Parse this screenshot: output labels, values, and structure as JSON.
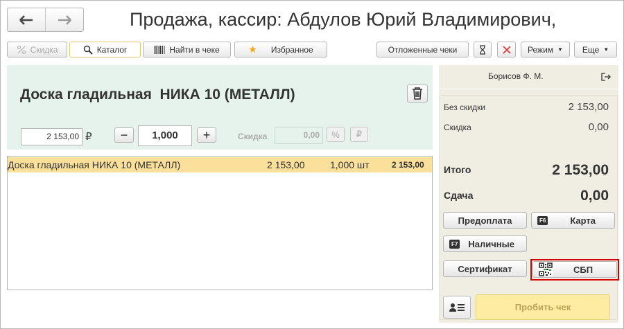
{
  "window": {
    "title": "Продажа, кассир: Абдулов Юрий Владимирович,"
  },
  "toolbar": {
    "discount_label": "Скидка",
    "catalog_label": "Каталог",
    "find_in_check_label": "Найти в чеке",
    "favorites_label": "Избранное",
    "deferred_checks_label": "Отложенные чеки",
    "mode_label": "Режим",
    "more_label": "Еще"
  },
  "product": {
    "name": "Доска гладильная  НИКА 10 (МЕТАЛЛ)",
    "price": "2 153,00",
    "currency_symbol": "₽",
    "quantity": "1,000",
    "discount_label": "Скидка",
    "discount_value": "0,00",
    "percent_symbol": "%",
    "ruble_symbol": "₽"
  },
  "check_items": [
    {
      "name": "Доска гладильная  НИКА 10 (МЕТАЛЛ)",
      "price": "2 153,00",
      "quantity": "1,000 шт",
      "total": "2 153,00"
    }
  ],
  "customer": {
    "name": "Борисов Ф. М."
  },
  "totals": {
    "without_discount_label": "Без скидки",
    "without_discount_value": "2 153,00",
    "discount_label": "Скидка",
    "discount_value": "0,00",
    "total_label": "Итого",
    "total_value": "2 153,00",
    "change_label": "Сдача",
    "change_value": "0,00"
  },
  "payment": {
    "prepayment_label": "Предоплата",
    "card_key": "F6",
    "card_label": "Карта",
    "cash_key": "F7",
    "cash_label": "Наличные",
    "certificate_label": "Сертификат",
    "sbp_label": "СБП",
    "print_check_label": "Пробить чек"
  },
  "colors": {
    "product_panel_bg": "#e6f3ec",
    "selected_row_bg": "#fbe09b",
    "right_panel_bg": "#f0ede3",
    "highlight_border": "#d40000",
    "print_button_bg": "#fdeca1"
  }
}
